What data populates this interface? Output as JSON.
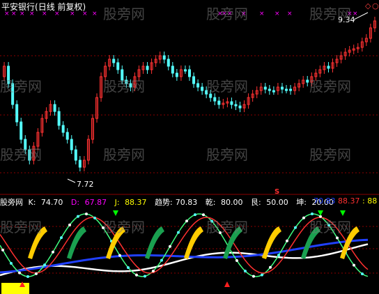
{
  "title": {
    "stock": "平安银行",
    "paren": "(日线 前复权)"
  },
  "price": {
    "high_label": "9.34",
    "low_label": "7.72"
  },
  "indicator": {
    "name": "股旁网",
    "k": {
      "label": "K:",
      "value": "74.70"
    },
    "d": {
      "label": "D:",
      "value": "67.87"
    },
    "j": {
      "label": "J:",
      "value": "88.37"
    },
    "trend": {
      "label": "趋势:",
      "value": "70.83"
    },
    "qian": {
      "label": "乾:",
      "value": "80.00"
    },
    "gen": {
      "label": "艮:",
      "value": "50.00"
    },
    "kun": {
      "label": "坤:",
      "value": "20.00"
    },
    "right1": "70.83",
    "right2": "88.37",
    "right3": ": 88"
  },
  "s_marker": "S",
  "watermark": "股旁网",
  "colors": {
    "up": "#ff3232",
    "down": "#54ffff",
    "k": "#ffffff",
    "d": "#ff00ff",
    "j": "#ffff00",
    "trend": "#2040ff"
  }
}
